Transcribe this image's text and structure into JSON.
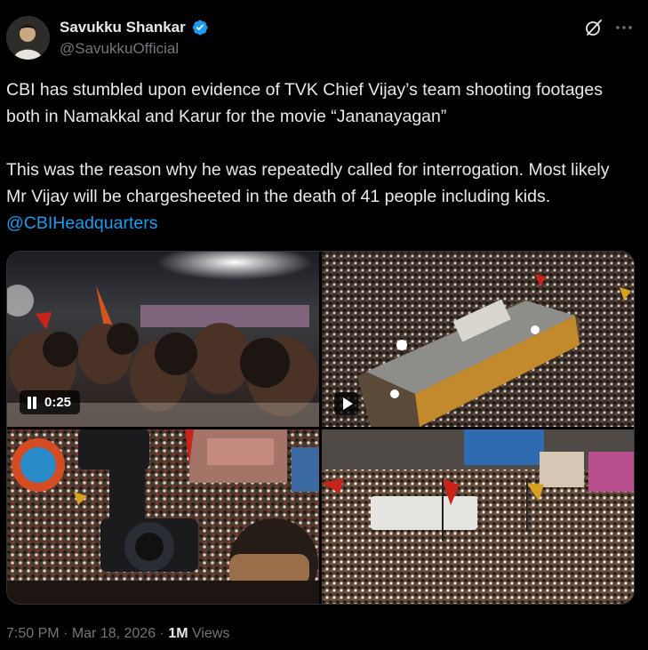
{
  "author": {
    "display_name": "Savukku Shankar",
    "handle": "@SavukkuOfficial",
    "verified_icon": "verified-badge-icon"
  },
  "header_actions": {
    "grok_icon": "grok-icon",
    "more_icon": "more-options-icon"
  },
  "tweet": {
    "paragraph1": "CBI has stumbled upon evidence of TVK Chief Vijay’s team shooting footages both in Namakkal and Karur for the movie “Jananayagan”",
    "paragraph2": "This was the reason why he was repeatedly called for interrogation. Most likely Mr Vijay will be chargesheeted in the death of 41 people including kids. ",
    "mention": "@CBIHeadquarters"
  },
  "media": {
    "video1_duration": "0:25",
    "video1_control_icon": "pause-icon",
    "video2_control_icon": "play-icon"
  },
  "meta": {
    "time": "7:50 PM",
    "separator": " · ",
    "date": "Mar 18, 2026",
    "separator2": " · ",
    "views_count": "1M",
    "views_label": " Views"
  },
  "colors": {
    "background": "#000000",
    "text": "#e7e9ea",
    "secondary": "#71767b",
    "link": "#1d9bf0",
    "verified": "#1d9bf0"
  }
}
